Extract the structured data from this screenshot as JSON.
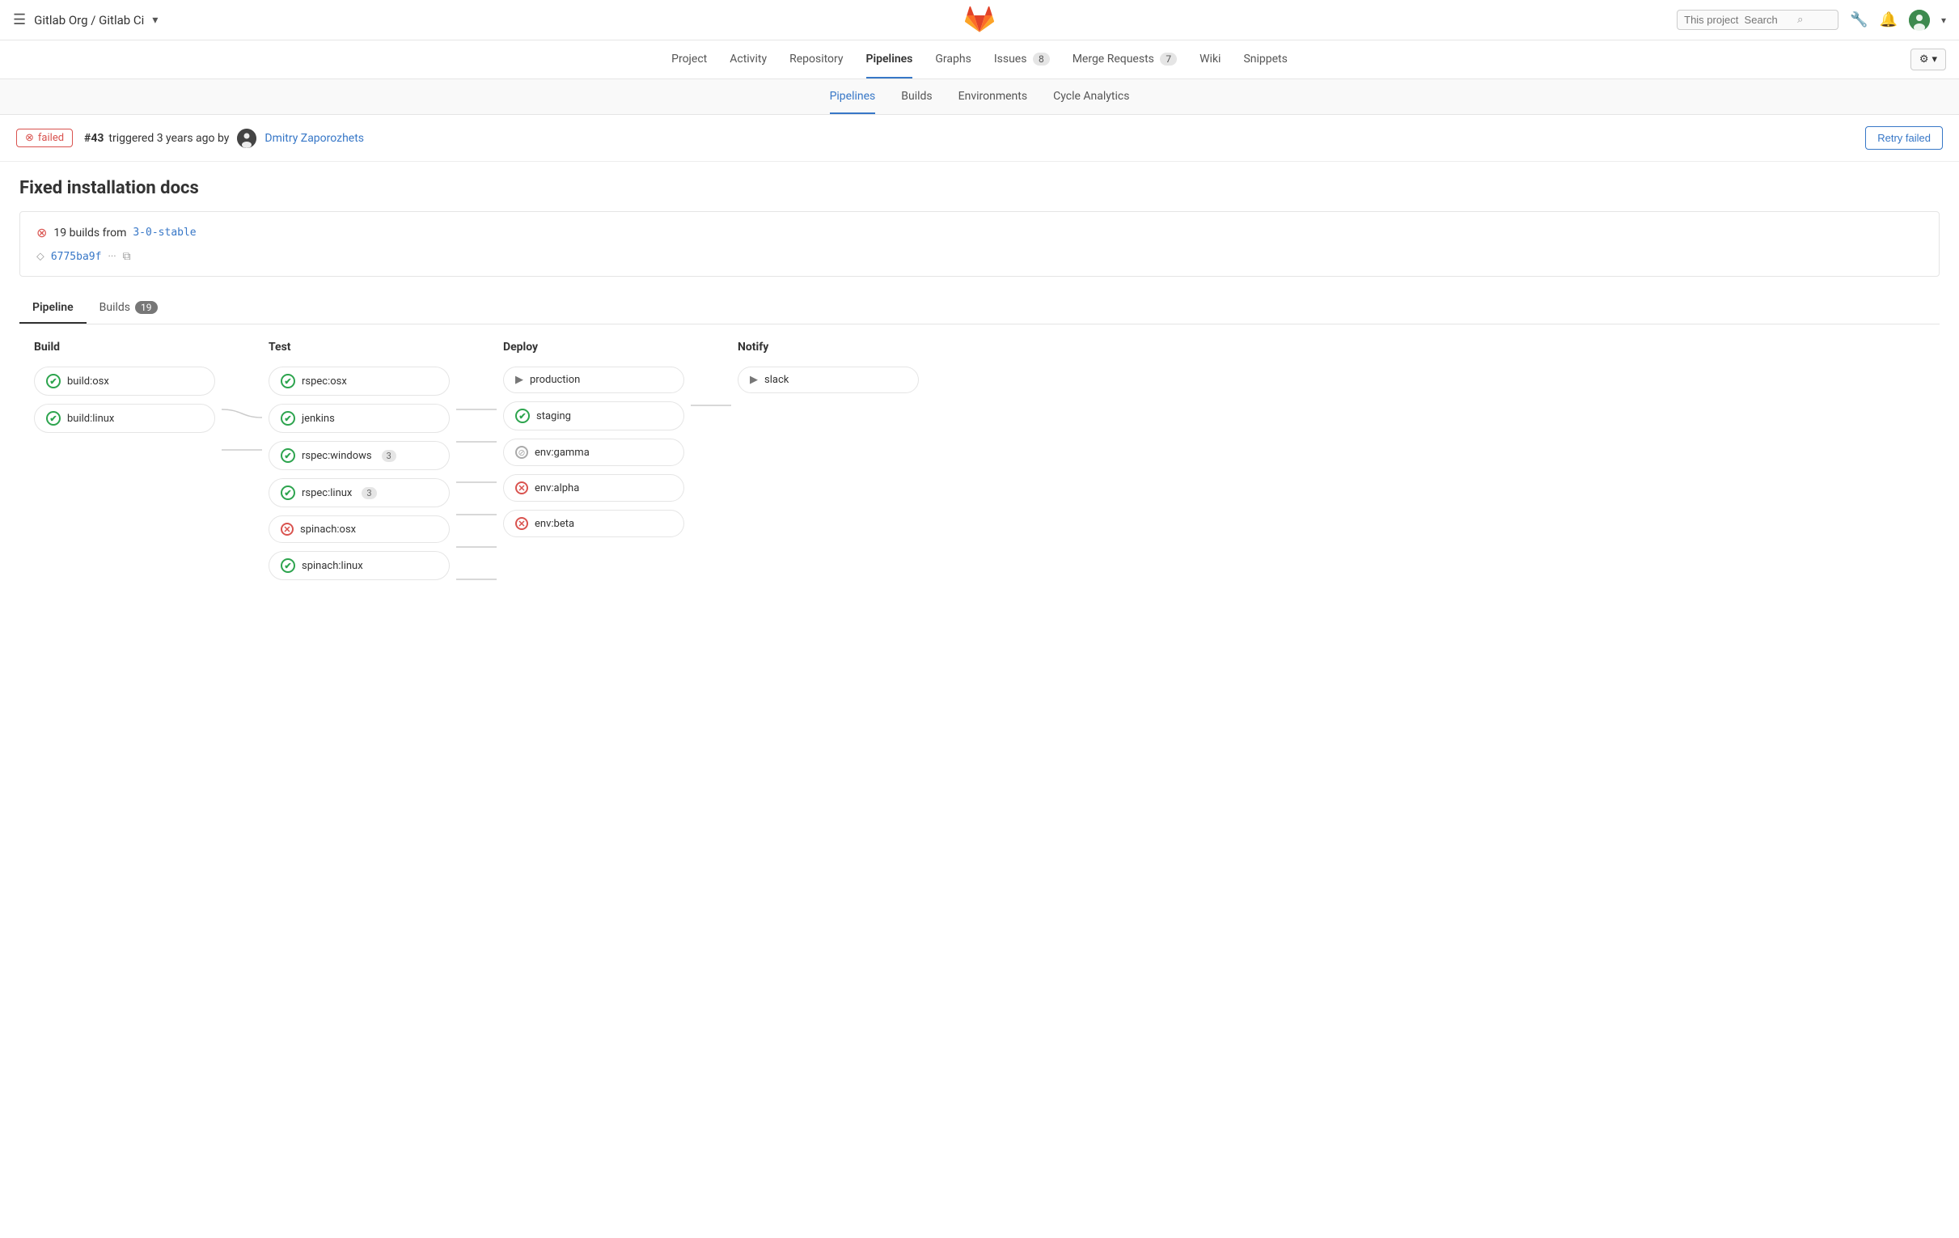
{
  "brand": "Gitlab Org / Gitlab Ci",
  "search": {
    "placeholder": "This project  Search"
  },
  "top_nav": {
    "items": [
      {
        "label": "Project"
      },
      {
        "label": "Activity"
      },
      {
        "label": "Repository"
      },
      {
        "label": "Pipelines",
        "active": true
      },
      {
        "label": "Graphs"
      },
      {
        "label": "Issues",
        "badge": "8"
      },
      {
        "label": "Merge Requests",
        "badge": "7"
      },
      {
        "label": "Wiki"
      },
      {
        "label": "Snippets"
      }
    ]
  },
  "secondary_nav": {
    "items": [
      {
        "label": "Pipelines",
        "active": true
      },
      {
        "label": "Builds"
      },
      {
        "label": "Environments"
      },
      {
        "label": "Cycle Analytics"
      }
    ]
  },
  "pipeline": {
    "status": "failed",
    "number": "#43",
    "triggered_text": "triggered 3 years ago by",
    "user": "Dmitry Zaporozhets",
    "retry_label": "Retry failed"
  },
  "page_title": "Fixed installation docs",
  "builds_info": {
    "count": "19",
    "text": "builds from",
    "branch": "3-0-stable"
  },
  "commit": {
    "hash": "6775ba9f",
    "copy_label": "Copy"
  },
  "tabs": {
    "pipeline_label": "Pipeline",
    "builds_label": "Builds",
    "builds_count": "19"
  },
  "stages": [
    {
      "name": "Build",
      "jobs": [
        {
          "name": "build:osx",
          "status": "success"
        },
        {
          "name": "build:linux",
          "status": "success"
        }
      ]
    },
    {
      "name": "Test",
      "jobs": [
        {
          "name": "rspec:osx",
          "status": "success"
        },
        {
          "name": "jenkins",
          "status": "success"
        },
        {
          "name": "rspec:windows",
          "status": "success",
          "badge": "3"
        },
        {
          "name": "rspec:linux",
          "status": "success",
          "badge": "3"
        },
        {
          "name": "spinach:osx",
          "status": "failed"
        },
        {
          "name": "spinach:linux",
          "status": "success"
        }
      ]
    },
    {
      "name": "Deploy",
      "jobs": [
        {
          "name": "production",
          "status": "pending"
        },
        {
          "name": "staging",
          "status": "success"
        },
        {
          "name": "env:gamma",
          "status": "skipped"
        },
        {
          "name": "env:alpha",
          "status": "failed"
        },
        {
          "name": "env:beta",
          "status": "failed"
        }
      ]
    },
    {
      "name": "Notify",
      "jobs": [
        {
          "name": "slack",
          "status": "pending"
        }
      ]
    }
  ],
  "icons": {
    "hamburger": "☰",
    "search": "🔍",
    "wrench": "🔧",
    "bell": "🔔",
    "chevron_down": "▾",
    "gear": "⚙",
    "failed_circle": "⊗",
    "commit": "◉",
    "copy": "⧉",
    "success": "✓",
    "failed": "✕",
    "skipped": "⊘",
    "pending": "▶"
  },
  "colors": {
    "success": "#2da44e",
    "failed": "#d9534f",
    "skipped": "#aaa",
    "pending": "#777",
    "brand_blue": "#3777c7"
  }
}
